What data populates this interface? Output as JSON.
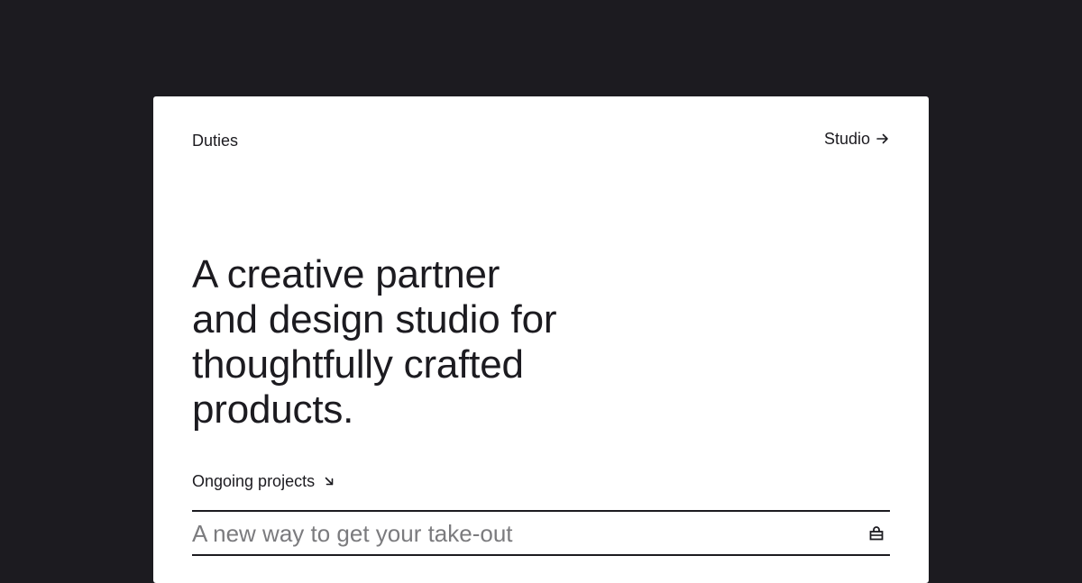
{
  "header": {
    "brand": "Duties",
    "nav_link": "Studio",
    "nav_icon": "arrow-right-icon"
  },
  "hero": {
    "line1": "A creative partner",
    "line2": "and design studio for",
    "line3": "thoughtfully crafted",
    "line4": "products."
  },
  "projects": {
    "label": "Ongoing projects",
    "label_icon": "arrow-down-right-icon",
    "items": [
      {
        "title": "A new way to get your take-out",
        "icon": "shopping-bag-icon"
      }
    ]
  },
  "colors": {
    "background": "#1c1b20",
    "card": "#ffffff",
    "text": "#1c1b20",
    "muted": "#7b7b7e"
  }
}
